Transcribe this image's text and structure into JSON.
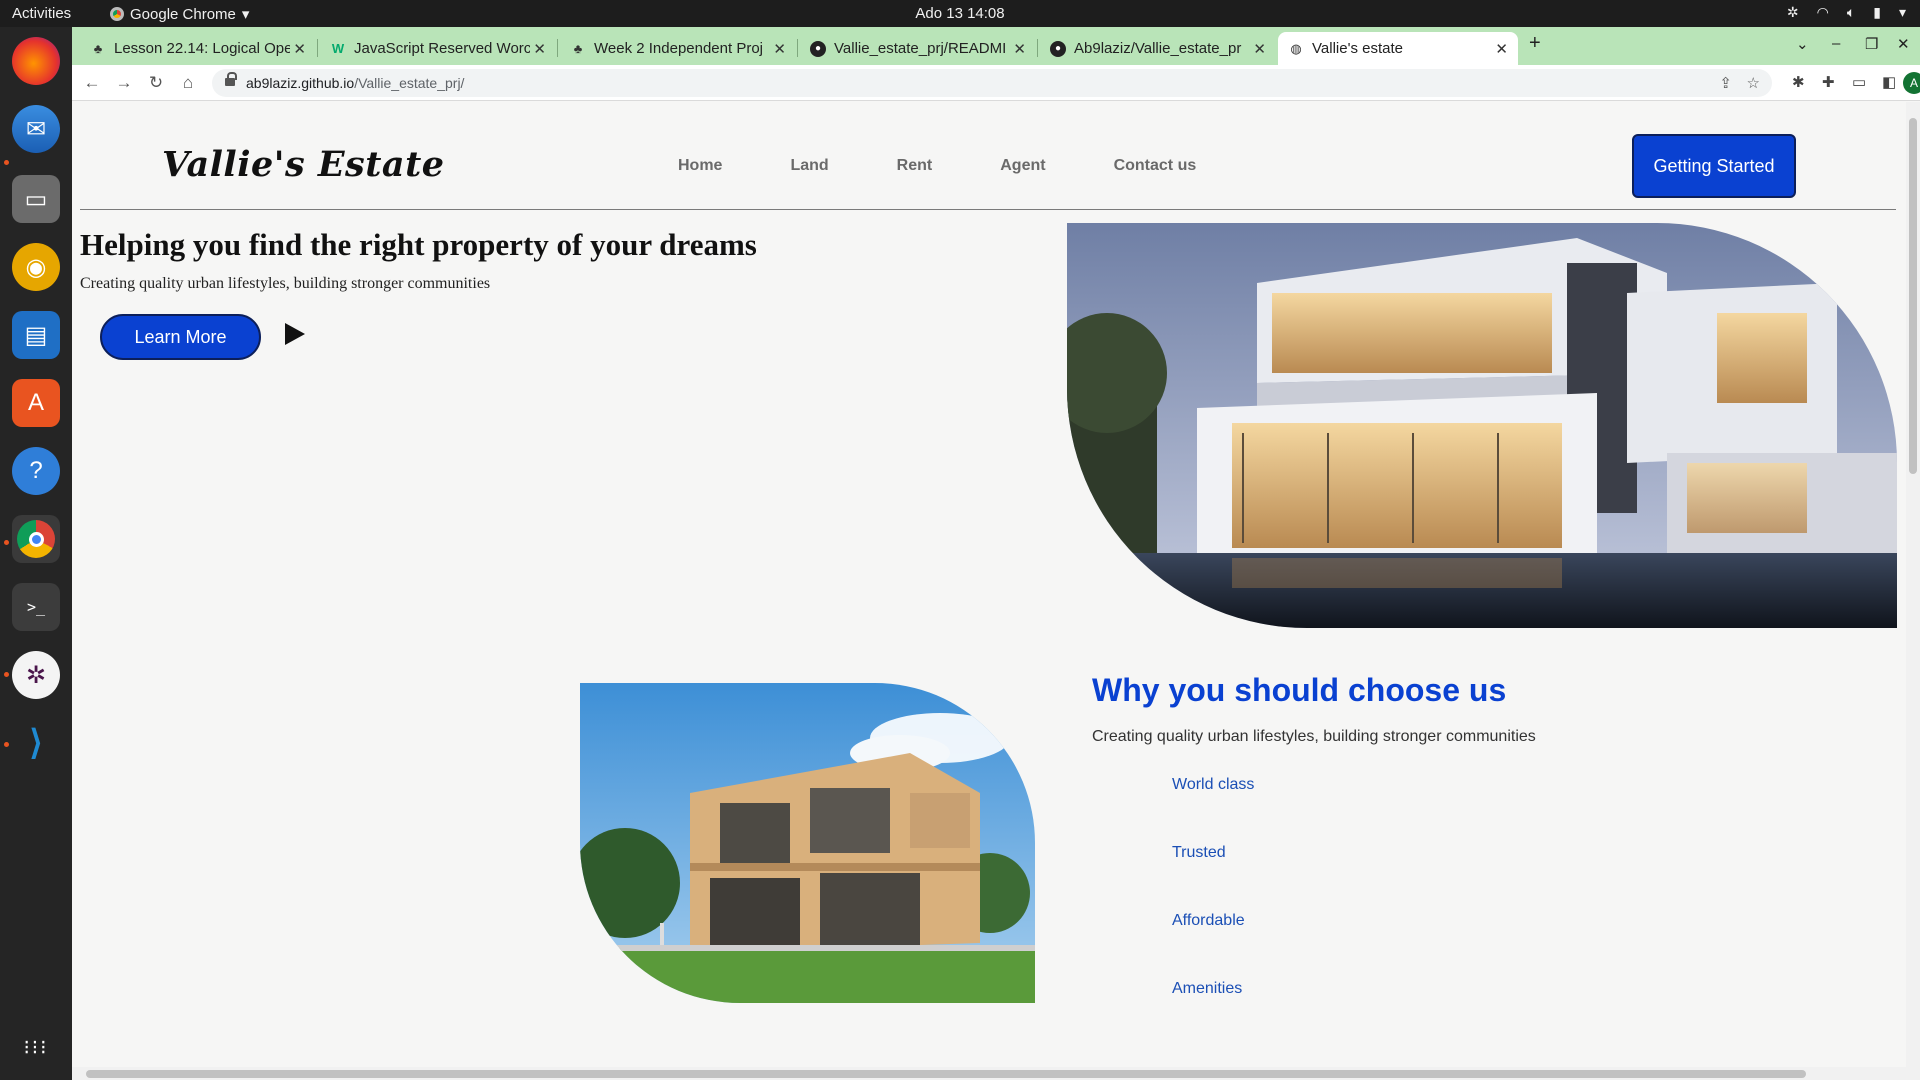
{
  "os": {
    "activities": "Activities",
    "app_name": "Google Chrome",
    "clock": "Ado 13  14:08"
  },
  "browser": {
    "tabs": [
      {
        "title": "Lesson 22.14: Logical Ope",
        "icon": "sprout-icon",
        "active": false
      },
      {
        "title": "JavaScript Reserved Worc",
        "icon": "w3schools-icon",
        "active": false
      },
      {
        "title": "Week 2 Independent Proj",
        "icon": "sprout-icon",
        "active": false
      },
      {
        "title": "Vallie_estate_prj/READMI",
        "icon": "github-icon",
        "active": false
      },
      {
        "title": "Ab9laziz/Vallie_estate_pr",
        "icon": "github-icon",
        "active": false
      },
      {
        "title": "Vallie's estate",
        "icon": "globe-icon",
        "active": true
      }
    ],
    "url_host": "ab9laziz.github.io",
    "url_path": "/Vallie_estate_prj/",
    "profile_initial": "A"
  },
  "site": {
    "logo": "Vallie's Estate",
    "nav": [
      "Home",
      "Land",
      "Rent",
      "Agent",
      "Contact us"
    ],
    "cta": "Getting Started",
    "hero": {
      "title": "Helping you find the right property of your dreams",
      "subtitle": "Creating quality urban lifestyles, building stronger communities",
      "button": "Learn More"
    },
    "why": {
      "title": "Why you should choose us",
      "subtitle": "Creating quality urban lifestyles, building stronger communities",
      "items": [
        "World class",
        "Trusted",
        "Affordable",
        "Amenities"
      ]
    },
    "colors": {
      "primary": "#0a41d1",
      "tabstrip": "#b9e4b8"
    }
  }
}
